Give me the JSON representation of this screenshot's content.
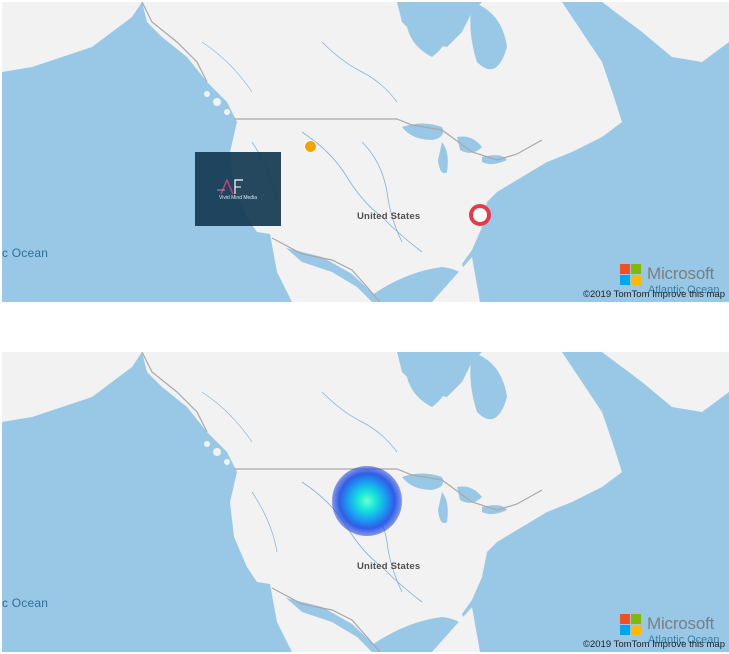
{
  "maps": [
    {
      "id": "top",
      "ocean_label": "c Ocean",
      "country_label": "United States",
      "atlantic_label": "Atlantic Ocean",
      "logo_text": "Microsoft",
      "copyright": "©2019 TomTom",
      "improve_link": "Improve this map",
      "popup_caption": "Vivid Mind Media",
      "markers": [
        "orange-dot-marker",
        "red-ring-marker"
      ]
    },
    {
      "id": "bottom",
      "ocean_label": "c Ocean",
      "country_label": "United States",
      "atlantic_label": "Atlantic Ocean",
      "logo_text": "Microsoft",
      "copyright": "©2019 TomTom",
      "improve_link": "Improve this map",
      "markers": [
        "heatmap-blob"
      ]
    }
  ],
  "colors": {
    "water": "#98c8e6",
    "land": "#f2f2f2",
    "border": "#a8a8a8",
    "river": "#7fb0d8",
    "marker_orange": "#f5a300",
    "marker_red": "#e63b47",
    "popup_bg": "#163c54"
  }
}
